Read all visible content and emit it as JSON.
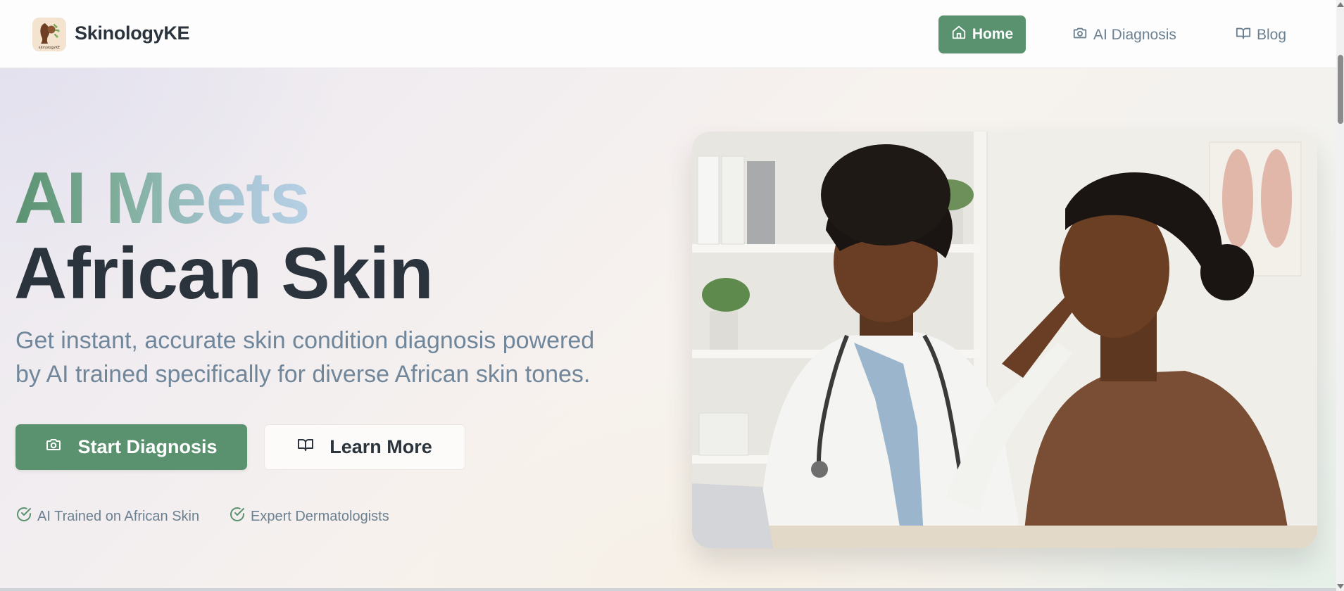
{
  "header": {
    "brand": "SkinologyKE",
    "logo_text": "skinologyKE",
    "nav": {
      "home": "Home",
      "ai_diagnosis": "AI Diagnosis",
      "blog": "Blog"
    }
  },
  "hero": {
    "title_line1": "AI Meets",
    "title_line2": "African Skin",
    "subtitle_line1": "Get instant, accurate skin condition diagnosis powered",
    "subtitle_line2": "by AI trained specifically for diverse African skin tones.",
    "primary_button": "Start Diagnosis",
    "secondary_button": "Learn More",
    "features": [
      "AI Trained on African Skin",
      "Expert Dermatologists"
    ]
  },
  "icons": {
    "home": "home-icon",
    "camera": "camera-icon",
    "book": "book-icon",
    "check": "check-circle-icon"
  },
  "colors": {
    "brand_green": "#5a9270",
    "dark_text": "#2b343c",
    "muted_text": "#70869a",
    "gradient_end": "#b6cfe4"
  }
}
